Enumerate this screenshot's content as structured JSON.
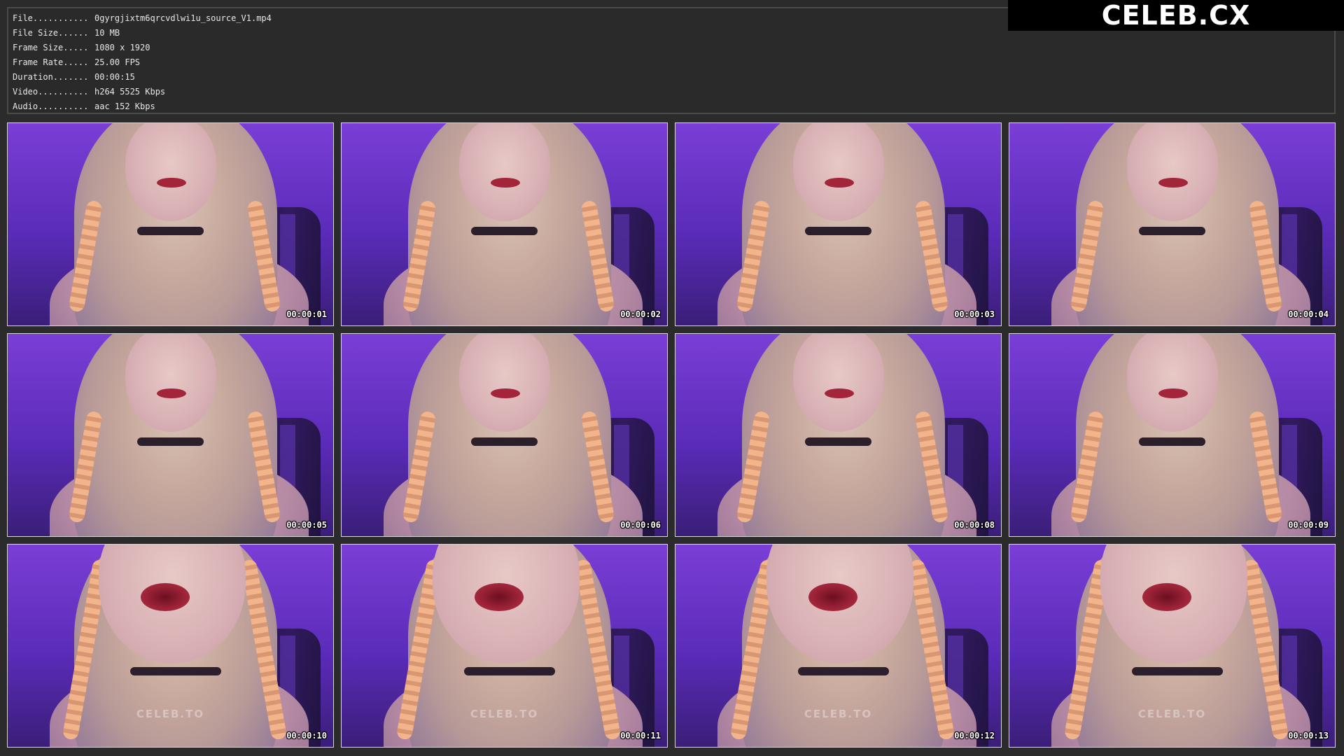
{
  "info": {
    "rows": [
      {
        "key": "File...........",
        "value": "0gyrgjixtm6qrcvdlwi1u_source_V1.mp4"
      },
      {
        "key": "File Size......",
        "value": "10 MB"
      },
      {
        "key": "Frame Size.....",
        "value": "1080 x 1920"
      },
      {
        "key": "Frame Rate.....",
        "value": "25.00 FPS"
      },
      {
        "key": "Duration.......",
        "value": "00:00:15"
      },
      {
        "key": "Video..........",
        "value": "h264 5525 Kbps"
      },
      {
        "key": "Audio..........",
        "value": "aac 152 Kbps"
      }
    ]
  },
  "logo": {
    "text": "CELEB.CX"
  },
  "thumbnails": [
    {
      "timestamp": "00:00:01",
      "watermark": ""
    },
    {
      "timestamp": "00:00:02",
      "watermark": ""
    },
    {
      "timestamp": "00:00:03",
      "watermark": ""
    },
    {
      "timestamp": "00:00:04",
      "watermark": ""
    },
    {
      "timestamp": "00:00:05",
      "watermark": ""
    },
    {
      "timestamp": "00:00:06",
      "watermark": ""
    },
    {
      "timestamp": "00:00:08",
      "watermark": ""
    },
    {
      "timestamp": "00:00:09",
      "watermark": ""
    },
    {
      "timestamp": "00:00:10",
      "watermark": "CELEB.TO"
    },
    {
      "timestamp": "00:00:11",
      "watermark": "CELEB.TO"
    },
    {
      "timestamp": "00:00:12",
      "watermark": "CELEB.TO"
    },
    {
      "timestamp": "00:00:13",
      "watermark": "CELEB.TO"
    }
  ],
  "colors": {
    "background": "#2b2b2b",
    "panel_border": "#4a4a4a",
    "thumb_border": "#d6d6d6",
    "purple_backdrop": "#7a3ed6",
    "text": "#e6e6e6"
  }
}
